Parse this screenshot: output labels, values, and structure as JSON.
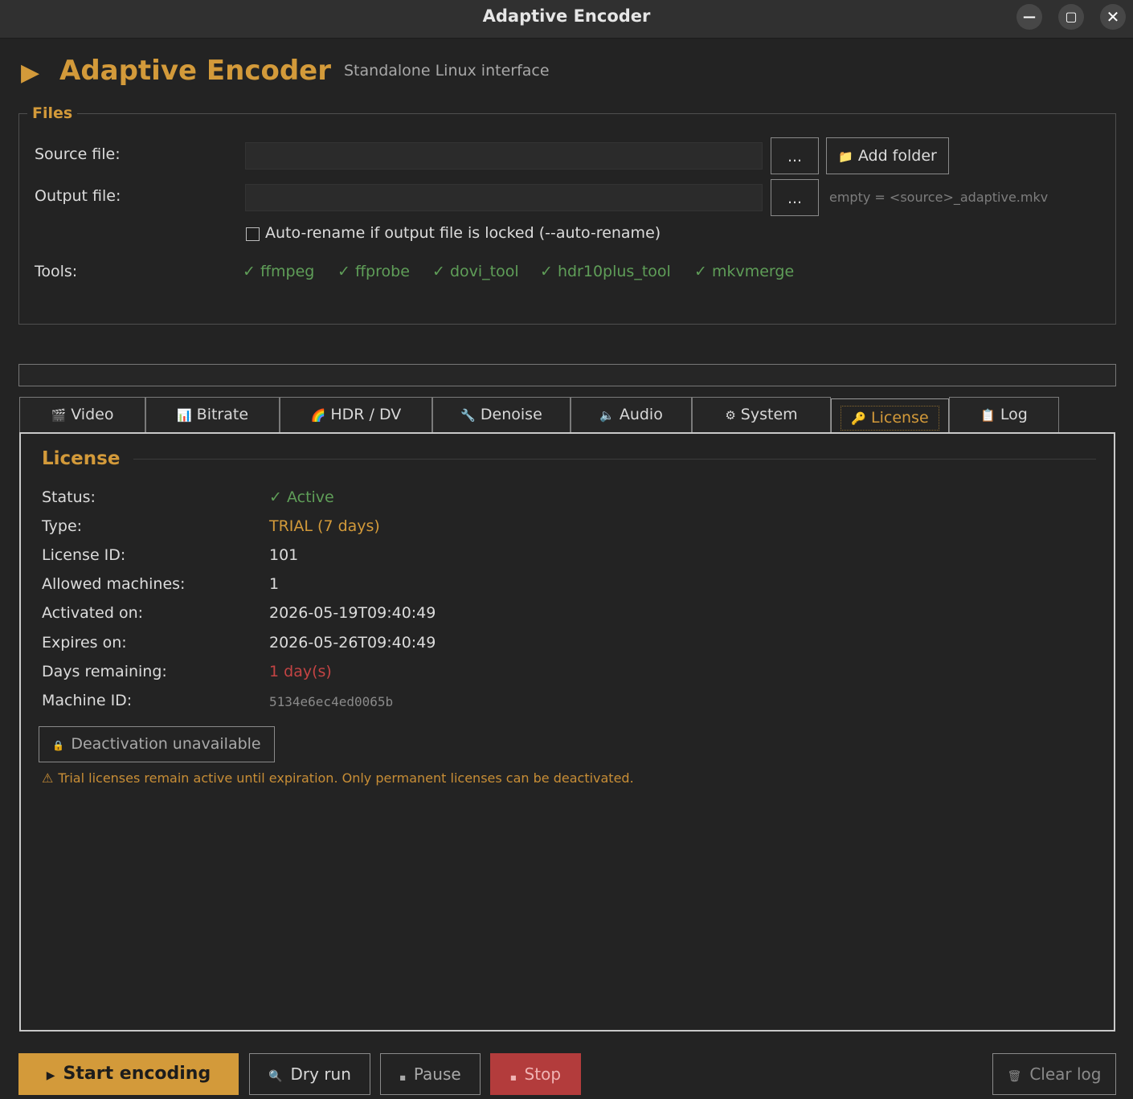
{
  "window": {
    "title": "Adaptive Encoder",
    "minimize_glyph": "—",
    "maximize_glyph": "▢",
    "close_glyph": "✕"
  },
  "header": {
    "icon": "▶",
    "title": "Adaptive Encoder",
    "subtitle": "Standalone Linux interface"
  },
  "files": {
    "legend": "Files",
    "source_label": "Source file:",
    "source_value": "",
    "output_label": "Output file:",
    "output_value": "",
    "browse_label": "...",
    "add_folder_icon": "📁",
    "add_folder_label": "Add folder",
    "output_hint": "empty = <source>_adaptive.mkv",
    "auto_rename_label": "Auto-rename if output file is locked  (--auto-rename)",
    "auto_rename_checked": false,
    "tools_label": "Tools:",
    "tools": [
      "✓ ffmpeg",
      "✓ ffprobe",
      "✓ dovi_tool",
      "✓ hdr10plus_tool",
      "✓ mkvmerge"
    ]
  },
  "progress": {
    "value": 0
  },
  "tabs": [
    {
      "icon": "🎬",
      "label": "Video"
    },
    {
      "icon": "📊",
      "label": "Bitrate"
    },
    {
      "icon": "🌈",
      "label": "HDR / DV"
    },
    {
      "icon": "🔧",
      "label": "Denoise"
    },
    {
      "icon": "🔈",
      "label": "Audio"
    },
    {
      "icon": "⚙",
      "label": "System"
    },
    {
      "icon": "🔑",
      "label": "License"
    },
    {
      "icon": "📋",
      "label": "Log"
    }
  ],
  "active_tab": "License",
  "license": {
    "title": "License",
    "rows": [
      {
        "label": "Status:",
        "value": "✓ Active"
      },
      {
        "label": "Type:",
        "value": "TRIAL (7 days)"
      },
      {
        "label": "License ID:",
        "value": "101"
      },
      {
        "label": "Allowed machines:",
        "value": "1"
      },
      {
        "label": "Activated on:",
        "value": "2026-05-19T09:40:49"
      },
      {
        "label": "Expires on:",
        "value": "2026-05-26T09:40:49"
      },
      {
        "label": "Days remaining:",
        "value": "1 day(s)"
      },
      {
        "label": "Machine ID:",
        "value": "5134e6ec4ed0065b"
      }
    ],
    "deactivate_icon": "🔒",
    "deactivate_label": "Deactivation unavailable",
    "warning_icon": "⚠",
    "warning_text": "Trial licenses remain active until expiration. Only permanent licenses can be deactivated."
  },
  "actions": {
    "start_icon": "▶",
    "start_label": "Start encoding",
    "dry_icon": "🔍",
    "dry_label": "Dry run",
    "pause_icon": "■",
    "pause_label": "Pause",
    "stop_icon": "■",
    "stop_label": "Stop",
    "clear_icon": "🗑",
    "clear_label": "Clear log"
  },
  "colors": {
    "accent": "#d39a3a",
    "ok": "#5f9e58",
    "danger": "#c44444",
    "stop_bg": "#b33c3c",
    "background": "#232323"
  }
}
